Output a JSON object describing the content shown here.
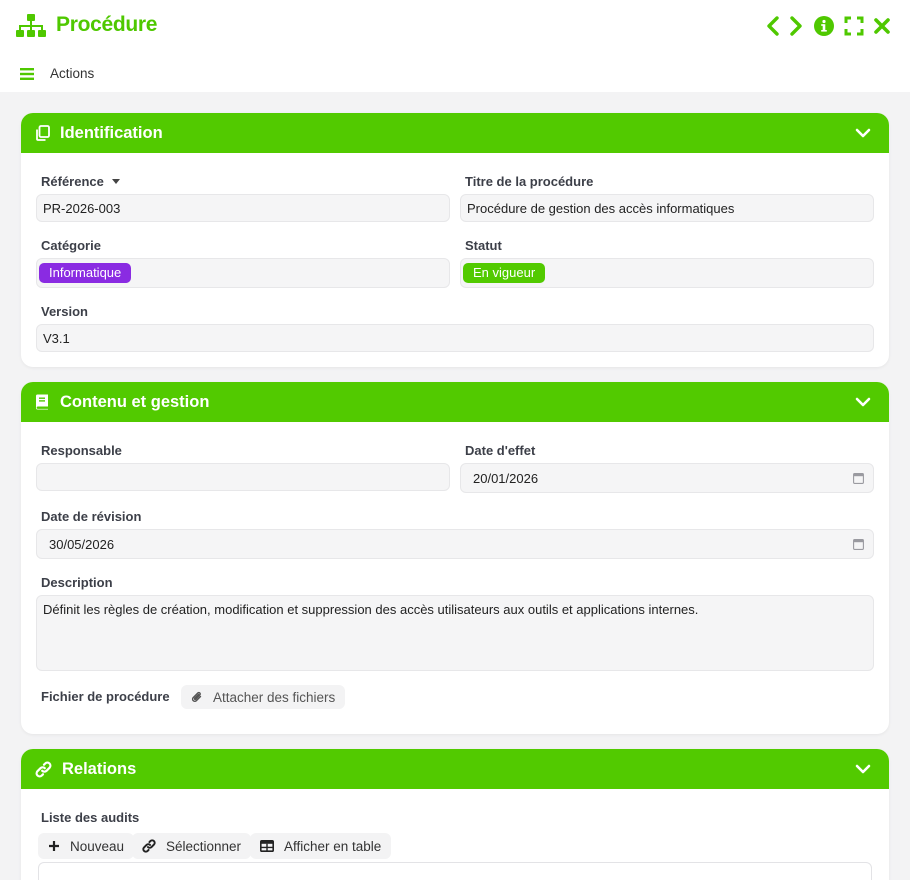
{
  "window": {
    "title": "Procédure",
    "icons": [
      "sitemap-icon",
      "chevron-left-icon",
      "chevron-right-icon",
      "info-circle-icon",
      "expand-icon",
      "close-icon"
    ]
  },
  "toolbar": {
    "actions_label": "Actions"
  },
  "colors": {
    "accent": "#52ca00",
    "accent_text": "#4fc800",
    "badge_category": "#8a2be2",
    "badge_status": "#52ca00"
  },
  "identification": {
    "title": "Identification",
    "reference_label": "Référence",
    "reference_value": "PR-2026-003",
    "title_label": "Titre de la procédure",
    "title_value": "Procédure de gestion des accès informatiques",
    "category_label": "Catégorie",
    "category_value": "Informatique",
    "status_label": "Statut",
    "status_value": "En vigueur",
    "version_label": "Version",
    "version_value": "V3.1"
  },
  "content": {
    "title": "Contenu et gestion",
    "owner_label": "Responsable",
    "owner_value": "",
    "effective_date_label": "Date d'effet",
    "effective_date_value": "20/01/2026",
    "revision_date_label": "Date de révision",
    "revision_date_value": "30/05/2026",
    "description_label": "Description",
    "description_value": "Définit les règles de création, modification et suppression des accès utilisateurs aux outils et applications internes.",
    "file_label": "Fichier de procédure",
    "attach_label": "Attacher des fichiers"
  },
  "relations": {
    "title": "Relations",
    "audits_label": "Liste des audits",
    "new_label": "Nouveau",
    "select_label": "Sélectionner",
    "table_view_label": "Afficher en table"
  }
}
